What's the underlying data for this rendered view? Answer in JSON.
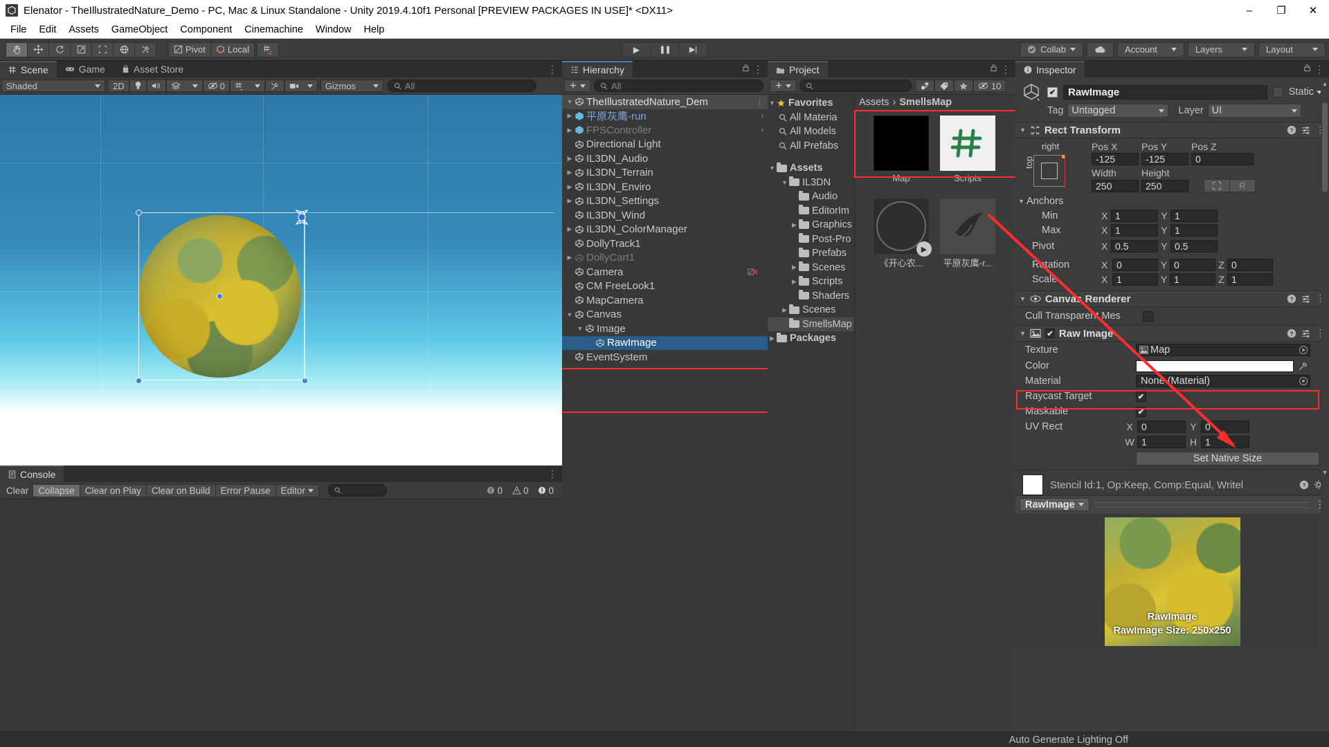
{
  "window": {
    "title": "Elenator - TheIllustratedNature_Demo - PC, Mac & Linux Standalone - Unity 2019.4.10f1 Personal [PREVIEW PACKAGES IN USE]* <DX11>",
    "app_icon": "unity-icon",
    "minimize": "–",
    "maximize": "❐",
    "close": "✕"
  },
  "menubar": [
    "File",
    "Edit",
    "Assets",
    "GameObject",
    "Component",
    "Cinemachine",
    "Window",
    "Help"
  ],
  "toolbar": {
    "tools": [
      "hand-tool",
      "move-tool",
      "rotate-tool",
      "scale-tool",
      "rect-tool",
      "transform-tool",
      "custom-tool"
    ],
    "pivot_label": "Pivot",
    "local_label": "Local",
    "play": "▶",
    "pause": "❚❚",
    "step": "▶|",
    "collab_label": "Collab",
    "account_label": "Account",
    "layers_label": "Layers",
    "layout_label": "Layout"
  },
  "scene": {
    "tabs": [
      {
        "label": "Scene",
        "icon": "grid-icon",
        "active": true
      },
      {
        "label": "Game",
        "icon": "gamepad-icon",
        "active": false
      },
      {
        "label": "Asset Store",
        "icon": "bag-icon",
        "active": false
      }
    ],
    "shading_mode": "Shaded",
    "mode_2d": "2D",
    "hidden_count": "0",
    "gizmos_label": "Gizmos",
    "search_placeholder": "All"
  },
  "console": {
    "tab_label": "Console",
    "buttons": [
      "Clear",
      "Collapse",
      "Clear on Play",
      "Clear on Build",
      "Error Pause"
    ],
    "mode_label": "Editor",
    "search_placeholder": "",
    "log_count": "0",
    "warn_count": "0",
    "error_count": "0"
  },
  "hierarchy": {
    "tab_label": "Hierarchy",
    "search_placeholder": "All",
    "root": "TheIllustratedNature_Dem",
    "items": [
      {
        "label": "平原灰鹰-run",
        "depth": 1,
        "twisty": true,
        "prefab": true,
        "overflow": true
      },
      {
        "label": "FPSController",
        "depth": 1,
        "twisty": true,
        "prefab": true,
        "dim": true,
        "overflow": true
      },
      {
        "label": "Directional Light",
        "depth": 1,
        "twisty": false
      },
      {
        "label": "IL3DN_Audio",
        "depth": 1,
        "twisty": true
      },
      {
        "label": "IL3DN_Terrain",
        "depth": 1,
        "twisty": true
      },
      {
        "label": "IL3DN_Enviro",
        "depth": 1,
        "twisty": true
      },
      {
        "label": "IL3DN_Settings",
        "depth": 1,
        "twisty": true
      },
      {
        "label": "IL3DN_Wind",
        "depth": 1,
        "twisty": false
      },
      {
        "label": "IL3DN_ColorManager",
        "depth": 1,
        "twisty": true
      },
      {
        "label": "DollyTrack1",
        "depth": 1,
        "twisty": false
      },
      {
        "label": "DollyCart1",
        "depth": 1,
        "twisty": true,
        "dim": true
      },
      {
        "label": "Camera",
        "depth": 1,
        "twisty": false,
        "badge": "camera-badge"
      },
      {
        "label": "CM FreeLook1",
        "depth": 1,
        "twisty": false
      },
      {
        "label": "MapCamera",
        "depth": 1,
        "twisty": false
      },
      {
        "label": "Canvas",
        "depth": 1,
        "twisty": true,
        "expanded": true
      },
      {
        "label": "Image",
        "depth": 2,
        "twisty": true,
        "expanded": true
      },
      {
        "label": "RawImage",
        "depth": 3,
        "twisty": false,
        "selected": true
      },
      {
        "label": "EventSystem",
        "depth": 1,
        "twisty": false
      }
    ]
  },
  "project": {
    "tab_label": "Project",
    "search_placeholder": "",
    "hidden_count": "10",
    "favorites_label": "Favorites",
    "favorites": [
      "All Materia",
      "All Models",
      "All Prefabs"
    ],
    "assets_label": "Assets",
    "tree": [
      {
        "label": "IL3DN",
        "depth": 1,
        "twisty": true,
        "expanded": true
      },
      {
        "label": "Audio",
        "depth": 2,
        "twisty": false
      },
      {
        "label": "EditorIm",
        "depth": 2,
        "twisty": false
      },
      {
        "label": "Graphics",
        "depth": 2,
        "twisty": true
      },
      {
        "label": "Post-Pro",
        "depth": 2,
        "twisty": false
      },
      {
        "label": "Prefabs",
        "depth": 2,
        "twisty": false
      },
      {
        "label": "Scenes",
        "depth": 2,
        "twisty": true
      },
      {
        "label": "Scripts",
        "depth": 2,
        "twisty": true
      },
      {
        "label": "Shaders",
        "depth": 2,
        "twisty": false
      },
      {
        "label": "Scenes",
        "depth": 1,
        "twisty": true
      },
      {
        "label": "SmellsMap",
        "depth": 1,
        "twisty": false,
        "selected": true
      }
    ],
    "packages_label": "Packages",
    "breadcrumb": [
      "Assets",
      "SmellsMap"
    ],
    "assets": [
      {
        "name": "Map",
        "type": "render-texture",
        "highlighted": true
      },
      {
        "name": "Scripts",
        "type": "folder-shortcut"
      },
      {
        "name": "《开心农...",
        "type": "audio-clip"
      },
      {
        "name": "平原灰鹰-r...",
        "type": "model-prefab"
      }
    ]
  },
  "inspector": {
    "tab_label": "Inspector",
    "object_name": "RawImage",
    "enabled": true,
    "static_label": "Static",
    "tag_label": "Tag",
    "tag_value": "Untagged",
    "layer_label": "Layer",
    "layer_value": "UI",
    "rect_transform": {
      "title": "Rect Transform",
      "anchor_preset_top": "top",
      "anchor_preset_right": "right",
      "pos_x_label": "Pos X",
      "pos_x": "-125",
      "pos_y_label": "Pos Y",
      "pos_y": "-125",
      "pos_z_label": "Pos Z",
      "pos_z": "0",
      "width_label": "Width",
      "width": "250",
      "height_label": "Height",
      "height": "250",
      "blueprint_btn": "blueprint-mode",
      "raw_btn": "R",
      "anchors_label": "Anchors",
      "min_label": "Min",
      "min_x": "1",
      "min_y": "1",
      "max_label": "Max",
      "max_x": "1",
      "max_y": "1",
      "pivot_label": "Pivot",
      "pivot_x": "0.5",
      "pivot_y": "0.5",
      "rotation_label": "Rotation",
      "rot_x": "0",
      "rot_y": "0",
      "rot_z": "0",
      "scale_label": "Scale",
      "scale_x": "1",
      "scale_y": "1",
      "scale_z": "1"
    },
    "canvas_renderer": {
      "title": "Canvas Renderer",
      "cull_label": "Cull Transparent Mes",
      "cull_checked": false
    },
    "raw_image": {
      "title": "Raw Image",
      "enabled": true,
      "texture_label": "Texture",
      "texture_value": "Map",
      "color_label": "Color",
      "color_value": "#FFFFFF",
      "material_label": "Material",
      "material_value": "None (Material)",
      "raycast_label": "Raycast Target",
      "raycast_checked": true,
      "maskable_label": "Maskable",
      "maskable_checked": true,
      "uv_rect_label": "UV Rect",
      "uv_x": "0",
      "uv_y": "0",
      "uv_w": "1",
      "uv_h": "1",
      "set_native_size": "Set Native Size"
    },
    "material_preview": {
      "text": "Stencil Id:1, Op:Keep, Comp:Equal, Writel"
    },
    "preview": {
      "dropdown_label": "RawImage",
      "caption_name": "RawImage",
      "caption_size": "RawImage Size: 250x250"
    }
  },
  "statusbar": {
    "text": "Auto Generate Lighting Off"
  },
  "colors": {
    "accent_blue": "#2a5c8a",
    "tab_accent": "#4d7fbb",
    "annotation_red": "#ff2d2d",
    "bg_panel": "#383838",
    "bg_toolbar": "#3c3c3c",
    "prefab_blue": "#7da6dd"
  }
}
